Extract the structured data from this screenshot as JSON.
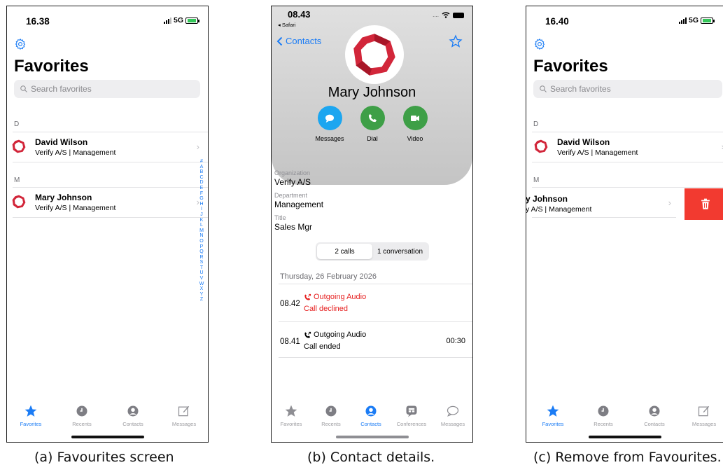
{
  "colors": {
    "accent": "#1b7cf5",
    "call_green": "#3e9f47",
    "messages_blue": "#1ca6f0",
    "declined_red": "#e61e1e",
    "delete_red": "#f23a30"
  },
  "captions": {
    "a": "(a) Favourites screen",
    "b": "(b) Contact details.",
    "c": "(c) Remove from Favourites."
  },
  "favorites_a": {
    "time": "16.38",
    "network": "5G",
    "title": "Favorites",
    "search_placeholder": "Search favorites",
    "sections": [
      {
        "header": "D",
        "contacts": [
          {
            "name": "David Wilson",
            "subtitle": "Verify A/S | Management"
          }
        ]
      },
      {
        "header": "M",
        "contacts": [
          {
            "name": "Mary Johnson",
            "subtitle": "Verify A/S | Management"
          }
        ]
      }
    ],
    "alphabet": [
      "#",
      "A",
      "B",
      "C",
      "D",
      "E",
      "F",
      "G",
      "H",
      "I",
      "J",
      "K",
      "L",
      "M",
      "N",
      "O",
      "P",
      "Q",
      "R",
      "S",
      "T",
      "U",
      "V",
      "W",
      "X",
      "Y",
      "Z"
    ]
  },
  "tabbar_a": [
    {
      "label": "Favorites",
      "icon": "star-icon",
      "active": true
    },
    {
      "label": "Recents",
      "icon": "clock-icon",
      "active": false
    },
    {
      "label": "Contacts",
      "icon": "person-icon",
      "active": false
    },
    {
      "label": "Messages",
      "icon": "compose-icon",
      "active": false
    }
  ],
  "contact_b": {
    "time": "08.43",
    "back_app": "◂ Safari",
    "back_label": "Contacts",
    "name": "Mary Johnson",
    "actions": [
      "Messages",
      "Dial",
      "Video"
    ],
    "fields": [
      {
        "label": "Organization",
        "value": "Verify A/S"
      },
      {
        "label": "Department",
        "value": "Management"
      },
      {
        "label": "Title",
        "value": "Sales Mgr"
      }
    ],
    "segments": [
      "2 calls",
      "1 conversation"
    ],
    "day": "Thursday, 26 February 2026",
    "calls": [
      {
        "time": "08.42",
        "kind": "Outgoing Audio",
        "result": "Call declined",
        "duration": "",
        "declined": true
      },
      {
        "time": "08.41",
        "kind": "Outgoing Audio",
        "result": "Call ended",
        "duration": "00:30",
        "declined": false
      }
    ]
  },
  "tabbar_b": [
    {
      "label": "Favorites",
      "icon": "star-icon",
      "active": false
    },
    {
      "label": "Recents",
      "icon": "clock-icon",
      "active": false
    },
    {
      "label": "Contacts",
      "icon": "person-icon",
      "active": true
    },
    {
      "label": "Conferences",
      "icon": "conference-icon",
      "active": false
    },
    {
      "label": "Messages",
      "icon": "chat-bubble-icon",
      "active": false
    }
  ],
  "favorites_c": {
    "time": "16.40",
    "network": "5G",
    "title": "Favorites",
    "search_placeholder": "Search favorites",
    "section_d": "D",
    "section_m": "M",
    "david_name": "David Wilson",
    "david_sub": "Verify A/S | Management",
    "mary_name_partial": "y Johnson",
    "mary_sub_partial": "y A/S | Management"
  },
  "tabbar_c": [
    {
      "label": "Favorites",
      "icon": "star-icon",
      "active": true
    },
    {
      "label": "Recents",
      "icon": "clock-icon",
      "active": false
    },
    {
      "label": "Contacts",
      "icon": "person-icon",
      "active": false
    },
    {
      "label": "Messages",
      "icon": "compose-icon",
      "active": false
    }
  ]
}
